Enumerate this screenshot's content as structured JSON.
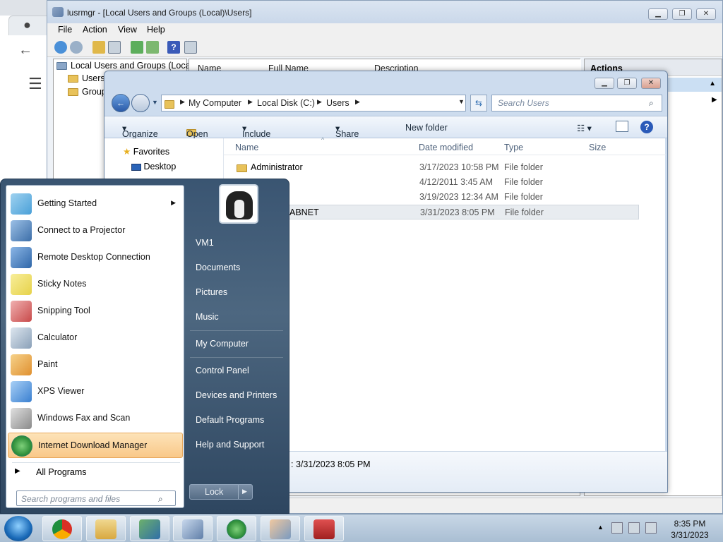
{
  "mmc": {
    "title": "lusrmgr - [Local Users and Groups (Local)\\Users]",
    "menu": [
      "File",
      "Action",
      "View",
      "Help"
    ],
    "tree": [
      "Local Users and Groups (Local)",
      "Users",
      "Group"
    ],
    "columns": [
      "Name",
      "Full Name",
      "Description"
    ],
    "actions_header": "Actions"
  },
  "explorer": {
    "address": [
      "My Computer",
      "Local Disk (C:)",
      "Users"
    ],
    "search_placeholder": "Search Users",
    "commands": [
      "Organize",
      "Open",
      "Include in library",
      "Share with",
      "New folder"
    ],
    "nav": {
      "favorites": "Favorites",
      "desktop": "Desktop"
    },
    "columns": [
      "Name",
      "Date modified",
      "Type",
      "Size"
    ],
    "rows": [
      {
        "name": "Administrator",
        "date": "3/17/2023 10:58 PM",
        "type": "File folder"
      },
      {
        "name": "",
        "date": "4/12/2011 3:45 AM",
        "type": "File folder"
      },
      {
        "name": "",
        "date": "3/19/2023 12:34 AM",
        "type": "File folder"
      },
      {
        "name": "ABNET",
        "date": "3/31/2023 8:05 PM",
        "type": "File folder"
      }
    ],
    "details_date": "3/31/2023 8:05 PM"
  },
  "start_menu": {
    "programs": [
      {
        "label": "Getting Started",
        "icon": "getting-started-icon",
        "color": "#4aa0d8"
      },
      {
        "label": "Connect to a Projector",
        "icon": "projector-icon",
        "color": "#3c6ea8"
      },
      {
        "label": "Remote Desktop Connection",
        "icon": "remote-desktop-icon",
        "color": "#2f66a8"
      },
      {
        "label": "Sticky Notes",
        "icon": "sticky-notes-icon",
        "color": "#e6d24a"
      },
      {
        "label": "Snipping Tool",
        "icon": "scissors-icon",
        "color": "#c84a4a"
      },
      {
        "label": "Calculator",
        "icon": "calculator-icon",
        "color": "#8aa0b8"
      },
      {
        "label": "Paint",
        "icon": "paint-icon",
        "color": "#e09030"
      },
      {
        "label": "XPS Viewer",
        "icon": "xps-viewer-icon",
        "color": "#3a7fd0"
      },
      {
        "label": "Windows Fax and Scan",
        "icon": "fax-icon",
        "color": "#8a8a8a"
      },
      {
        "label": "Internet Download Manager",
        "icon": "idm-icon",
        "color": "#2f8f3a"
      }
    ],
    "all_programs": "All Programs",
    "search_placeholder": "Search programs and files",
    "right_items": [
      "VM1",
      "Documents",
      "Pictures",
      "Music",
      "My Computer",
      "Control Panel",
      "Devices and Printers",
      "Default Programs",
      "Help and Support"
    ],
    "lock_label": "Lock"
  },
  "taskbar": {
    "time": "8:35 PM",
    "date": "3/31/2023"
  }
}
